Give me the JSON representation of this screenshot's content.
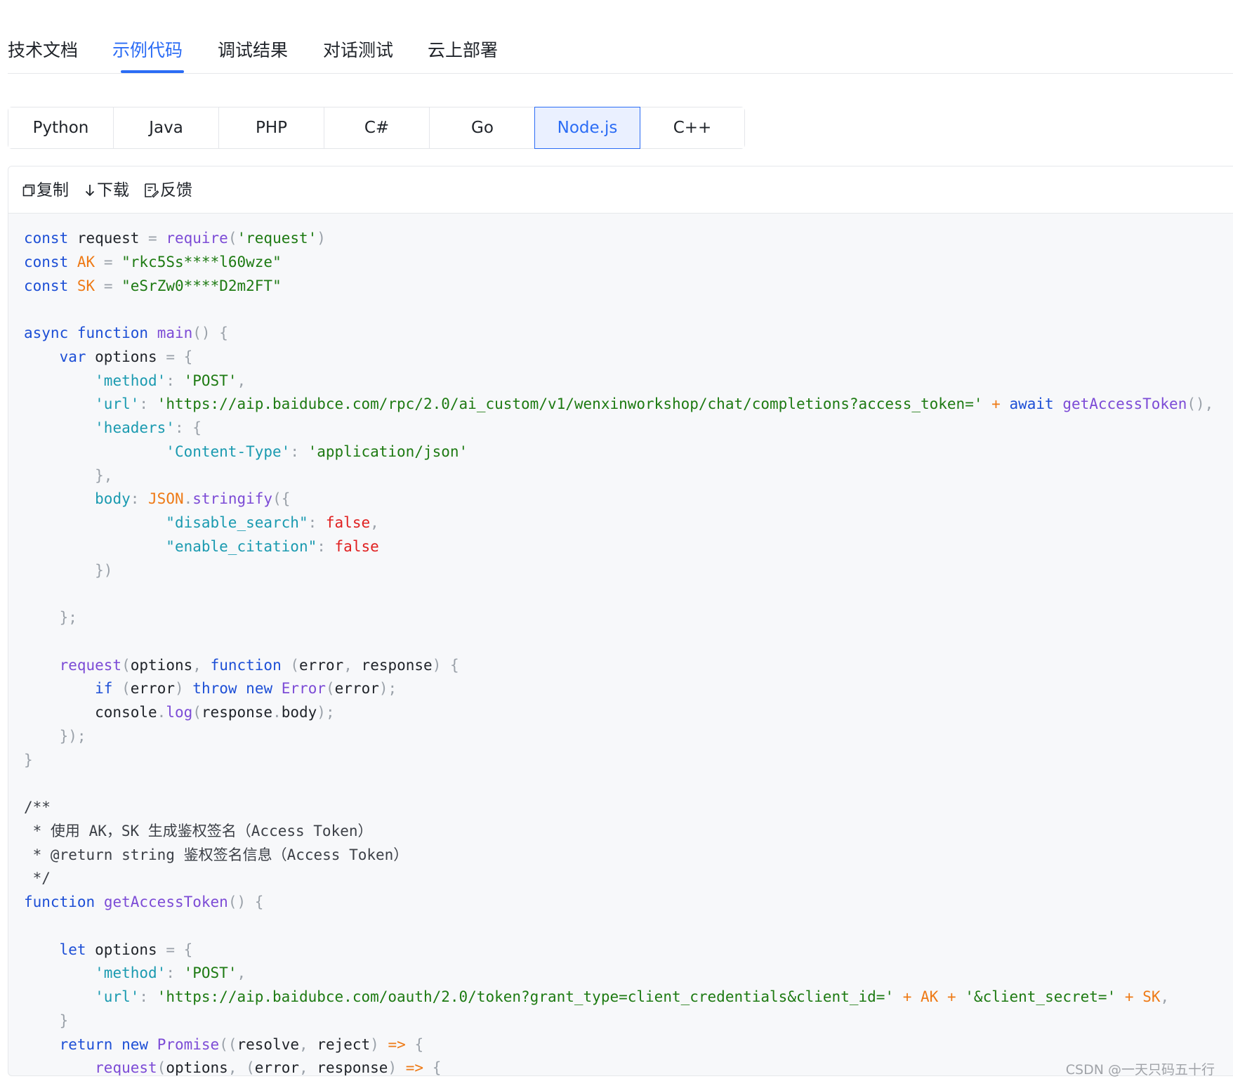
{
  "top_tabs": {
    "items": [
      {
        "label": "技术文档"
      },
      {
        "label": "示例代码",
        "active": true
      },
      {
        "label": "调试结果"
      },
      {
        "label": "对话测试"
      },
      {
        "label": "云上部署"
      }
    ]
  },
  "language_tabs": {
    "items": [
      {
        "label": "Python"
      },
      {
        "label": "Java"
      },
      {
        "label": "PHP"
      },
      {
        "label": "C#"
      },
      {
        "label": "Go"
      },
      {
        "label": "Node.js",
        "active": true
      },
      {
        "label": "C++"
      }
    ]
  },
  "toolbar": {
    "copy_label": "复制",
    "download_label": "下载",
    "feedback_label": "反馈"
  },
  "colors": {
    "accent": "#2b6cf5",
    "keyword": "#1d4fd6",
    "function": "#7c4bd6",
    "string": "#1d7a12",
    "object_key": "#1a9ab0",
    "constant": "#ee7a16",
    "boolean": "#e02020"
  },
  "code_lines": [
    [
      [
        "kw",
        "const"
      ],
      [
        "plain",
        " request "
      ],
      [
        "punc",
        "="
      ],
      [
        "plain",
        " "
      ],
      [
        "fn",
        "require"
      ],
      [
        "punc",
        "("
      ],
      [
        "str",
        "'request'"
      ],
      [
        "punc",
        ")"
      ]
    ],
    [
      [
        "kw",
        "const"
      ],
      [
        "plain",
        " "
      ],
      [
        "var",
        "AK"
      ],
      [
        "plain",
        " "
      ],
      [
        "punc",
        "="
      ],
      [
        "plain",
        " "
      ],
      [
        "str",
        "\"rkc5Ss****l60wze\""
      ]
    ],
    [
      [
        "kw",
        "const"
      ],
      [
        "plain",
        " "
      ],
      [
        "var",
        "SK"
      ],
      [
        "plain",
        " "
      ],
      [
        "punc",
        "="
      ],
      [
        "plain",
        " "
      ],
      [
        "str",
        "\"eSrZw0****D2m2FT\""
      ]
    ],
    [],
    [
      [
        "kw",
        "async"
      ],
      [
        "plain",
        " "
      ],
      [
        "kw",
        "function"
      ],
      [
        "plain",
        " "
      ],
      [
        "fn",
        "main"
      ],
      [
        "punc",
        "() {"
      ]
    ],
    [
      [
        "plain",
        "    "
      ],
      [
        "kw",
        "var"
      ],
      [
        "plain",
        " options "
      ],
      [
        "punc",
        "= {"
      ]
    ],
    [
      [
        "plain",
        "        "
      ],
      [
        "key",
        "'method'"
      ],
      [
        "punc",
        ": "
      ],
      [
        "str",
        "'POST'"
      ],
      [
        "punc",
        ","
      ]
    ],
    [
      [
        "plain",
        "        "
      ],
      [
        "key",
        "'url'"
      ],
      [
        "punc",
        ": "
      ],
      [
        "str",
        "'https://aip.baidubce.com/rpc/2.0/ai_custom/v1/wenxinworkshop/chat/completions?access_token='"
      ],
      [
        "plain",
        " "
      ],
      [
        "var",
        "+"
      ],
      [
        "plain",
        " "
      ],
      [
        "kw",
        "await"
      ],
      [
        "plain",
        " "
      ],
      [
        "fn",
        "getAccessToken"
      ],
      [
        "punc",
        "(),"
      ]
    ],
    [
      [
        "plain",
        "        "
      ],
      [
        "key",
        "'headers'"
      ],
      [
        "punc",
        ": {"
      ]
    ],
    [
      [
        "plain",
        "                "
      ],
      [
        "key",
        "'Content-Type'"
      ],
      [
        "punc",
        ": "
      ],
      [
        "str",
        "'application/json'"
      ]
    ],
    [
      [
        "plain",
        "        "
      ],
      [
        "punc",
        "},"
      ]
    ],
    [
      [
        "plain",
        "        "
      ],
      [
        "key",
        "body"
      ],
      [
        "punc",
        ": "
      ],
      [
        "var",
        "JSON"
      ],
      [
        "punc",
        "."
      ],
      [
        "fn",
        "stringify"
      ],
      [
        "punc",
        "({"
      ]
    ],
    [
      [
        "plain",
        "                "
      ],
      [
        "key",
        "\"disable_search\""
      ],
      [
        "punc",
        ": "
      ],
      [
        "bool",
        "false"
      ],
      [
        "punc",
        ","
      ]
    ],
    [
      [
        "plain",
        "                "
      ],
      [
        "key",
        "\"enable_citation\""
      ],
      [
        "punc",
        ": "
      ],
      [
        "bool",
        "false"
      ]
    ],
    [
      [
        "plain",
        "        "
      ],
      [
        "punc",
        "})"
      ]
    ],
    [],
    [
      [
        "plain",
        "    "
      ],
      [
        "punc",
        "};"
      ]
    ],
    [],
    [
      [
        "plain",
        "    "
      ],
      [
        "fn",
        "request"
      ],
      [
        "punc",
        "("
      ],
      [
        "plain",
        "options"
      ],
      [
        "punc",
        ", "
      ],
      [
        "kw",
        "function"
      ],
      [
        "plain",
        " "
      ],
      [
        "punc",
        "("
      ],
      [
        "plain",
        "error"
      ],
      [
        "punc",
        ", "
      ],
      [
        "plain",
        "response"
      ],
      [
        "punc",
        ") {"
      ]
    ],
    [
      [
        "plain",
        "        "
      ],
      [
        "kw",
        "if"
      ],
      [
        "plain",
        " "
      ],
      [
        "punc",
        "("
      ],
      [
        "plain",
        "error"
      ],
      [
        "punc",
        ")"
      ],
      [
        "plain",
        " "
      ],
      [
        "kw",
        "throw"
      ],
      [
        "plain",
        " "
      ],
      [
        "kw",
        "new"
      ],
      [
        "plain",
        " "
      ],
      [
        "fn",
        "Error"
      ],
      [
        "punc",
        "("
      ],
      [
        "plain",
        "error"
      ],
      [
        "punc",
        ");"
      ]
    ],
    [
      [
        "plain",
        "        console"
      ],
      [
        "punc",
        "."
      ],
      [
        "fn",
        "log"
      ],
      [
        "punc",
        "("
      ],
      [
        "plain",
        "response"
      ],
      [
        "punc",
        "."
      ],
      [
        "plain",
        "body"
      ],
      [
        "punc",
        ");"
      ]
    ],
    [
      [
        "plain",
        "    "
      ],
      [
        "punc",
        "});"
      ]
    ],
    [
      [
        "punc",
        "}"
      ]
    ],
    [],
    [
      [
        "com",
        "/**"
      ]
    ],
    [
      [
        "com",
        " * 使用 AK，SK 生成鉴权签名（Access Token）"
      ]
    ],
    [
      [
        "com",
        " * @return string 鉴权签名信息（Access Token）"
      ]
    ],
    [
      [
        "com",
        " */"
      ]
    ],
    [
      [
        "kw",
        "function"
      ],
      [
        "plain",
        " "
      ],
      [
        "fn",
        "getAccessToken"
      ],
      [
        "punc",
        "() {"
      ]
    ],
    [],
    [
      [
        "plain",
        "    "
      ],
      [
        "kw",
        "let"
      ],
      [
        "plain",
        " options "
      ],
      [
        "punc",
        "= {"
      ]
    ],
    [
      [
        "plain",
        "        "
      ],
      [
        "key",
        "'method'"
      ],
      [
        "punc",
        ": "
      ],
      [
        "str",
        "'POST'"
      ],
      [
        "punc",
        ","
      ]
    ],
    [
      [
        "plain",
        "        "
      ],
      [
        "key",
        "'url'"
      ],
      [
        "punc",
        ": "
      ],
      [
        "str",
        "'https://aip.baidubce.com/oauth/2.0/token?grant_type=client_credentials&client_id='"
      ],
      [
        "plain",
        " "
      ],
      [
        "var",
        "+"
      ],
      [
        "plain",
        " "
      ],
      [
        "var",
        "AK"
      ],
      [
        "plain",
        " "
      ],
      [
        "var",
        "+"
      ],
      [
        "plain",
        " "
      ],
      [
        "str",
        "'&client_secret='"
      ],
      [
        "plain",
        " "
      ],
      [
        "var",
        "+"
      ],
      [
        "plain",
        " "
      ],
      [
        "var",
        "SK"
      ],
      [
        "punc",
        ","
      ]
    ],
    [
      [
        "plain",
        "    "
      ],
      [
        "punc",
        "}"
      ]
    ],
    [
      [
        "plain",
        "    "
      ],
      [
        "kw",
        "return"
      ],
      [
        "plain",
        " "
      ],
      [
        "kw",
        "new"
      ],
      [
        "plain",
        " "
      ],
      [
        "fn",
        "Promise"
      ],
      [
        "punc",
        "(("
      ],
      [
        "plain",
        "resolve"
      ],
      [
        "punc",
        ", "
      ],
      [
        "plain",
        "reject"
      ],
      [
        "punc",
        ")"
      ],
      [
        "plain",
        " "
      ],
      [
        "var",
        "=>"
      ],
      [
        "plain",
        " "
      ],
      [
        "punc",
        "{"
      ]
    ],
    [
      [
        "plain",
        "        "
      ],
      [
        "fn",
        "request"
      ],
      [
        "punc",
        "("
      ],
      [
        "plain",
        "options"
      ],
      [
        "punc",
        ", ("
      ],
      [
        "plain",
        "error"
      ],
      [
        "punc",
        ", "
      ],
      [
        "plain",
        "response"
      ],
      [
        "punc",
        ")"
      ],
      [
        "plain",
        " "
      ],
      [
        "var",
        "=>"
      ],
      [
        "plain",
        " "
      ],
      [
        "punc",
        "{"
      ]
    ]
  ],
  "watermark": "CSDN @一天只码五十行"
}
